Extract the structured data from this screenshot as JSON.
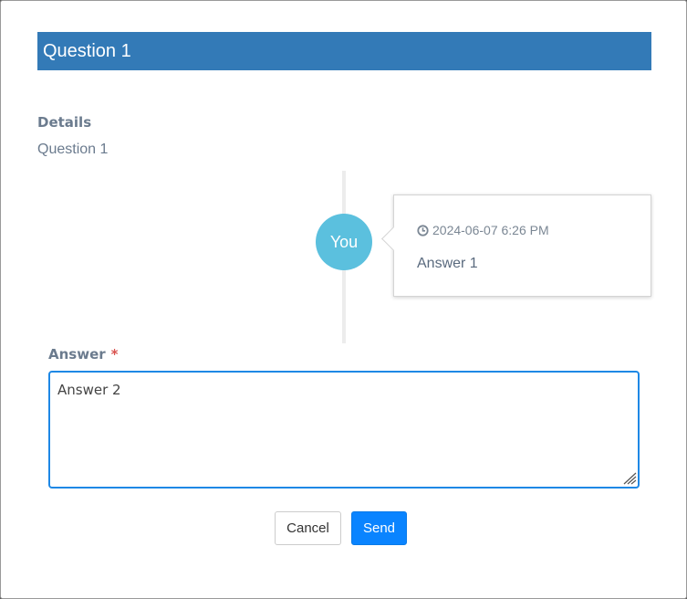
{
  "dialog": {
    "title": "Question 1",
    "details_label": "Details",
    "details_value": "Question 1"
  },
  "timeline": {
    "avatar_label": "You",
    "entries": [
      {
        "icon": "clock-icon",
        "timestamp": "2024-06-07 6:26 PM",
        "answer": "Answer 1"
      }
    ]
  },
  "form": {
    "answer_label": "Answer",
    "required_marker": "*",
    "answer_value": "Answer 2"
  },
  "actions": {
    "cancel_label": "Cancel",
    "send_label": "Send"
  },
  "colors": {
    "header": "#337ab7",
    "avatar": "#5bc0de",
    "send_button": "#0a84ff",
    "input_border": "#1e88e5",
    "required": "#d9534f"
  }
}
